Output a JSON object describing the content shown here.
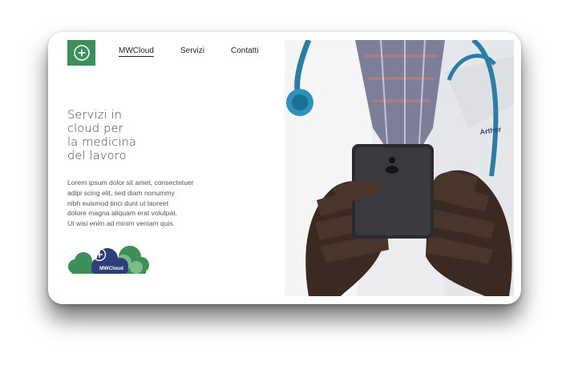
{
  "nav": {
    "items": [
      {
        "label": "MWCloud",
        "active": true
      },
      {
        "label": "Servizi",
        "active": false
      },
      {
        "label": "Contatti",
        "active": false
      }
    ]
  },
  "hero": {
    "headline_lines": [
      "Servizi in",
      "cloud per",
      "la medicina",
      "del lavoro"
    ],
    "body_lines": [
      "Lorem ipsum dolor sit amet, consectetuer",
      "adipi scing elit, sed diam nonummy",
      "nibh euismod tinci dunt ut laoreet",
      "dolore magna aliquam erat volutpat.",
      "Ut wisi enim ad minim veniam quis."
    ]
  },
  "brand": {
    "cloud_logo_text": "MWCloud",
    "coat_text": "Arther",
    "icon": "plus-circle-icon",
    "colors": {
      "green": "#3d8f5a",
      "navy": "#2c3f78"
    }
  },
  "photo": {
    "subject": "doctor-holding-smartphone"
  }
}
